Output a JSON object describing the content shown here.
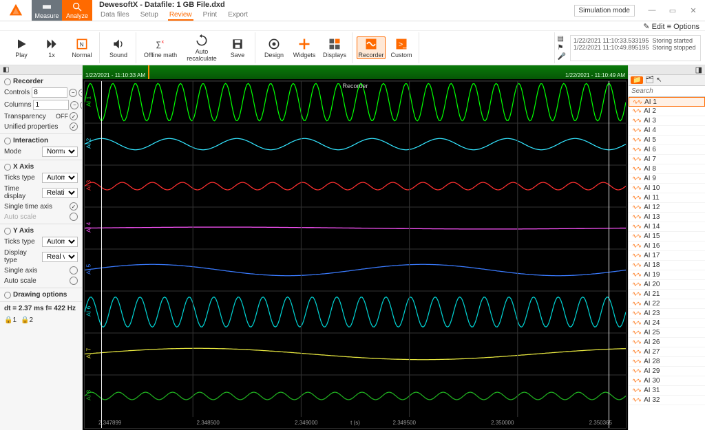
{
  "app": {
    "title": "DewesoftX - Datafile: 1 GB File.dxd",
    "sim_badge": "Simulation mode",
    "edit": "Edit",
    "options": "Options"
  },
  "modes": {
    "measure": "Measure",
    "analyze": "Analyze"
  },
  "menu": {
    "datafiles": "Data files",
    "setup": "Setup",
    "review": "Review",
    "print": "Print",
    "export": "Export"
  },
  "ribbon": {
    "play": "Play",
    "x1": "1x",
    "normal": "Normal",
    "sound": "Sound",
    "offlinemath": "Offline math",
    "autorecalc": "Auto recalculate",
    "save": "Save",
    "design": "Design",
    "widgets": "Widgets",
    "displays": "Displays",
    "recorder": "Recorder",
    "custom": "Custom"
  },
  "log": [
    {
      "ts": "1/22/2021 11:10:33.533195",
      "msg": "Storing started"
    },
    {
      "ts": "1/22/2021 11:10:49.895195",
      "msg": "Storing stopped"
    }
  ],
  "timebar": {
    "left": "1/22/2021 - 11:10:33 AM",
    "right": "1/22/2021 - 11:10:49 AM"
  },
  "plot": {
    "title": "Recorder",
    "xlabel": "t (s)",
    "xleft": "2.347899",
    "x1": "2.348500",
    "x2": "2.349000",
    "x3": "2.349500",
    "x4": "2.350000",
    "xright": "2.350365"
  },
  "left": {
    "recorder_hdr": "Recorder",
    "controls": "Controls",
    "controls_val": "8",
    "columns": "Columns",
    "columns_val": "1",
    "transparency": "Transparency",
    "transparency_val": "OFF",
    "unified": "Unified properties",
    "interaction_hdr": "Interaction",
    "mode": "Mode",
    "mode_val": "Normal",
    "xaxis_hdr": "X Axis",
    "tickstype": "Ticks type",
    "tickstype_val": "Automatic",
    "timedisplay": "Time display",
    "timedisplay_val": "Relative",
    "singletime": "Single time axis",
    "autoscale": "Auto scale",
    "yaxis_hdr": "Y Axis",
    "ytickstype": "Ticks type",
    "ytickstype_val": "Automatic",
    "displaytype": "Display type",
    "displaytype_val": "Real value",
    "singleaxis": "Single axis",
    "yautoscale": "Auto scale",
    "drawing_hdr": "Drawing options",
    "status": "dt = 2.37 ms  f= 422 Hz",
    "lock1": "1",
    "lock2": "2"
  },
  "search": {
    "placeholder": "Search"
  },
  "channels": [
    "AI 1",
    "AI 2",
    "AI 3",
    "AI 4",
    "AI 5",
    "AI 6",
    "AI 7",
    "AI 8",
    "AI 9",
    "AI 10",
    "AI 11",
    "AI 12",
    "AI 13",
    "AI 14",
    "AI 15",
    "AI 16",
    "AI 17",
    "AI 18",
    "AI 19",
    "AI 20",
    "AI 21",
    "AI 22",
    "AI 23",
    "AI 24",
    "AI 25",
    "AI 26",
    "AI 27",
    "AI 28",
    "AI 29",
    "AI 30",
    "AI 31",
    "AI 32"
  ],
  "chart_data": {
    "type": "line",
    "title": "Recorder",
    "xlabel": "t (s)",
    "xlim": [
      2.347899,
      2.350365
    ],
    "series": [
      {
        "name": "AI 1",
        "color": "#00ff00",
        "ylim": [
          -0.5,
          0.5
        ],
        "cycles": 24,
        "amp": 0.5
      },
      {
        "name": "AI 2",
        "color": "#33e5ff",
        "ylim": [
          -10,
          10
        ],
        "cycles": 8,
        "amp": 3
      },
      {
        "name": "AI 3",
        "color": "#ff3030",
        "ylim": [
          -10,
          10
        ],
        "cycles": 18,
        "amp": 2
      },
      {
        "name": "AI 4",
        "color": "#ff55ff",
        "ylim": [
          -10,
          10
        ],
        "cycles": 1,
        "amp": 0.5
      },
      {
        "name": "AI 5",
        "color": "#3a7bff",
        "ylim": [
          -10,
          10
        ],
        "cycles": 2,
        "amp": 3
      },
      {
        "name": "AI 6",
        "color": "#00d0d0",
        "ylim": [
          -5,
          5
        ],
        "cycles": 22,
        "amp": 4
      },
      {
        "name": "AI 7",
        "color": "#e8e840",
        "ylim": [
          -10,
          10
        ],
        "cycles": 1.2,
        "amp": 3
      },
      {
        "name": "AI 8",
        "color": "#20b020",
        "ylim": [
          -10,
          10
        ],
        "cycles": 20,
        "amp": 2
      }
    ]
  }
}
